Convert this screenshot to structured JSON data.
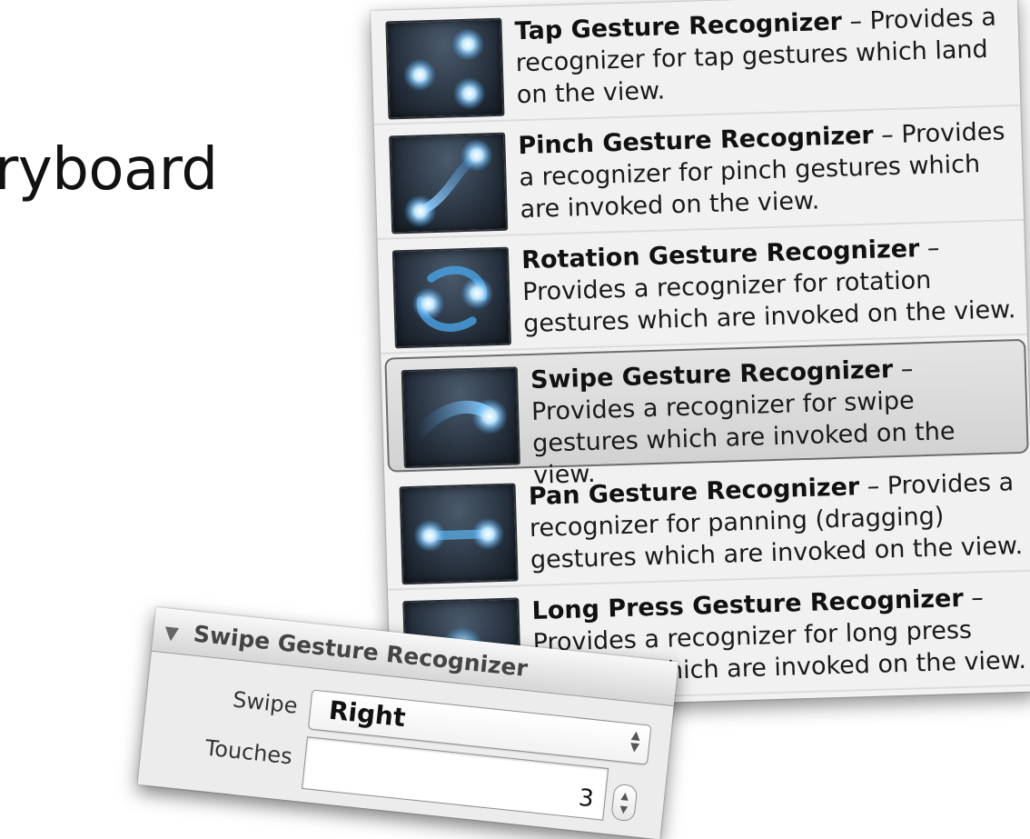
{
  "slide": {
    "title_fragment": "ryboard"
  },
  "library": {
    "items": [
      {
        "name": "Tap Gesture Recognizer",
        "description": " – Provides a recognizer for tap gestures which land on the view.",
        "icon": "tap-gesture-icon"
      },
      {
        "name": "Pinch Gesture Recognizer",
        "description": " – Provides a recognizer for pinch gestures which are invoked on the view.",
        "icon": "pinch-gesture-icon"
      },
      {
        "name": "Rotation Gesture Recognizer",
        "description": " – Provides a recognizer for rotation gestures which are invoked on the view.",
        "icon": "rotation-gesture-icon"
      },
      {
        "name": "Swipe Gesture Recognizer",
        "description": " – Provides a recognizer for swipe gestures which are invoked on the view.",
        "icon": "swipe-gesture-icon",
        "selected": true
      },
      {
        "name": "Pan Gesture Recognizer",
        "description": " – Provides a recognizer for panning (dragging) gestures which are invoked on the view.",
        "icon": "pan-gesture-icon"
      },
      {
        "name": "Long Press Gesture Recognizer",
        "description": " – Provides a recognizer for long press gestures which are invoked on the view.",
        "icon": "long-press-gesture-icon"
      }
    ]
  },
  "inspector": {
    "section_title": "Swipe Gesture Recognizer",
    "swipe_label": "Swipe",
    "swipe_value": "Right",
    "touches_label": "Touches",
    "touches_value": "3"
  },
  "colors": {
    "icon_glow": "#bfe6ff",
    "icon_bg": "#1f2833",
    "selected_border": "#6c6c6c"
  }
}
